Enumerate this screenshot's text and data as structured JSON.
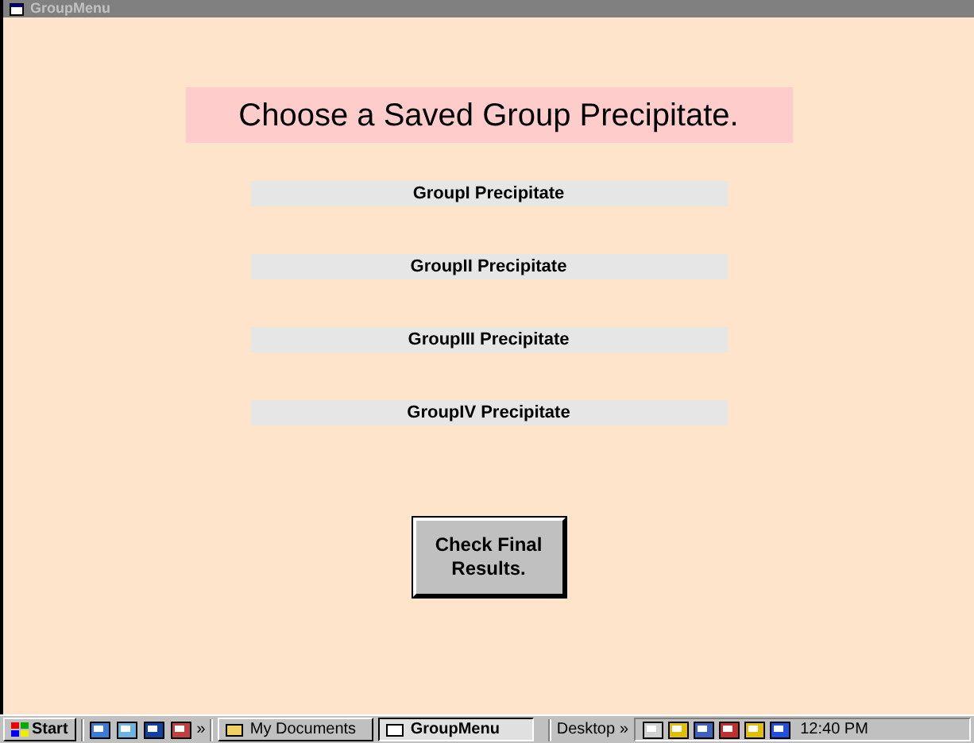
{
  "window": {
    "title": "GroupMenu"
  },
  "heading": "Choose a Saved Group Precipitate.",
  "groups": [
    "GroupI Precipitate",
    "GroupII Precipitate",
    "GroupIII Precipitate",
    "GroupIV Precipitate"
  ],
  "check_button": "Check Final Results.",
  "taskbar": {
    "start": "Start",
    "chevron": "»",
    "tasks": [
      {
        "label": "My Documents",
        "selected": false
      },
      {
        "label": "GroupMenu",
        "selected": true
      }
    ],
    "desktop": "Desktop",
    "desktop_chevron": "»",
    "clock": "12:40 PM"
  }
}
